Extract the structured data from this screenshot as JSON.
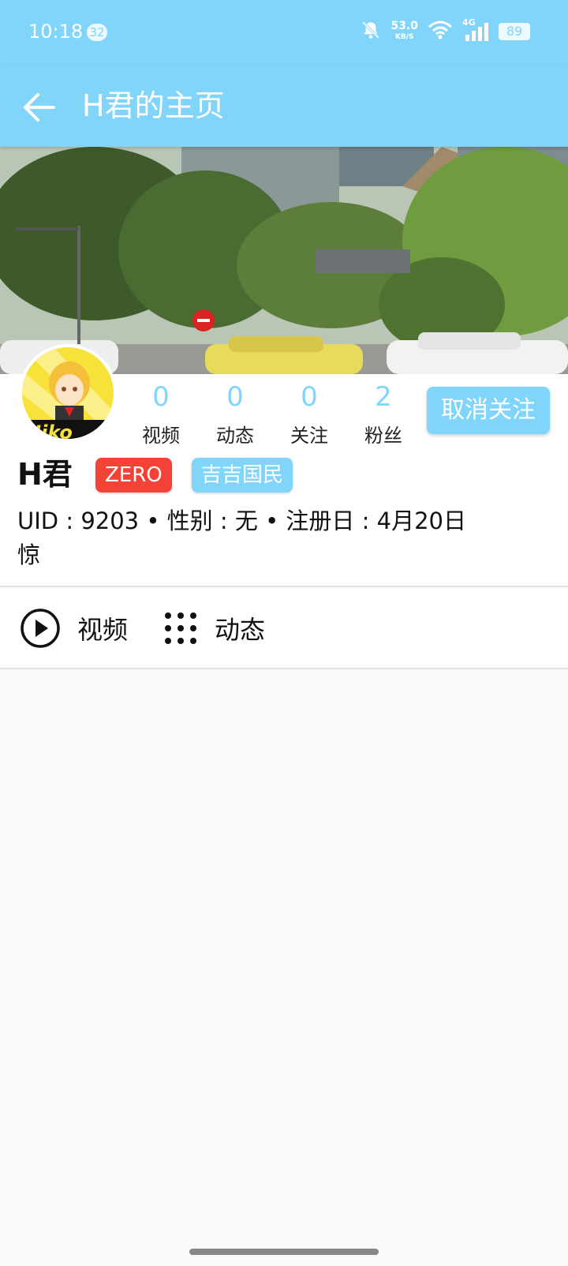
{
  "status_bar": {
    "time": "10:18",
    "notification_count": "32",
    "net_speed": "53.0",
    "net_speed_unit": "KB/S",
    "network_type": "4G",
    "battery": "89",
    "icons": [
      "bell-muted-icon",
      "wifi-icon",
      "signal-icon",
      "battery-icon"
    ]
  },
  "app_bar": {
    "title": "H君的主页",
    "back_icon": "arrow-left-icon"
  },
  "profile": {
    "stats": [
      {
        "value": "0",
        "label": "视频"
      },
      {
        "value": "0",
        "label": "动态"
      },
      {
        "value": "0",
        "label": "关注"
      },
      {
        "value": "2",
        "label": "粉丝"
      }
    ],
    "unfollow_label": "取消关注",
    "username": "H君",
    "tags": [
      "ZERO",
      "吉吉国民"
    ],
    "info_line": "UID : 9203 • 性别 : 无 • 注册日 : 4月20日",
    "bio": "惊"
  },
  "tabs": [
    {
      "label": "视频",
      "icon": "play-circle-icon"
    },
    {
      "label": "动态",
      "icon": "dots-grid-icon"
    }
  ],
  "colors": {
    "accent": "#81d4fa",
    "tag_red": "#f44336",
    "background": "#f9f9f9"
  }
}
